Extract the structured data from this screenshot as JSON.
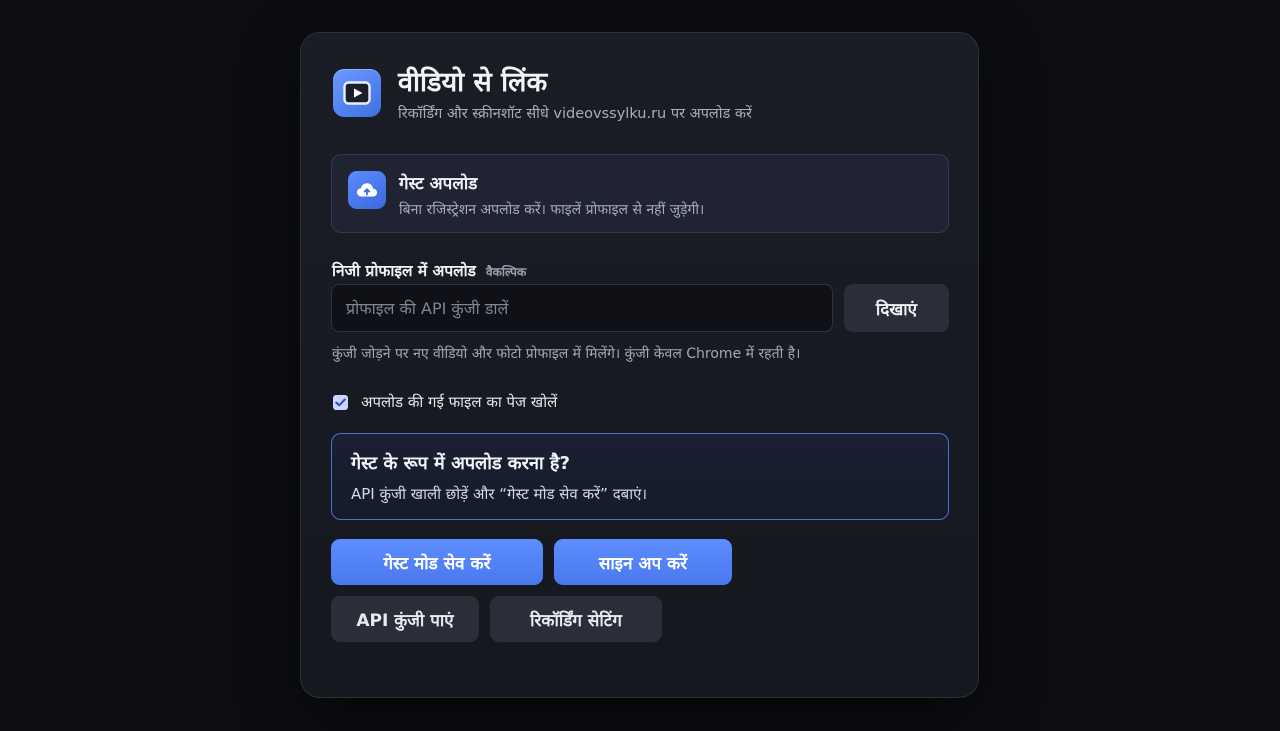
{
  "header": {
    "title": "वीडियो से लिंक",
    "subtitle": "रिकॉर्डिंग और स्क्रीनशॉट सीधे videovssylku.ru पर अपलोड करें"
  },
  "guest_card": {
    "title": "गेस्ट अपलोड",
    "description": "बिना रजिस्ट्रेशन अपलोड करें। फाइलें प्रोफाइल से नहीं जुड़ेगी।"
  },
  "profile_field": {
    "label": "निजी प्रोफाइल में अपलोड",
    "optional_tag": "वैकल्पिक",
    "placeholder": "प्रोफाइल की API कुंजी डालें",
    "value": "",
    "show_label": "दिखाएं",
    "hint": "कुंजी जोड़ने पर नए वीडियो और फोटो प्रोफाइल में मिलेंगे।  कुंजी केवल Chrome में रहती है।"
  },
  "open_page_checkbox": {
    "label": "अपलोड की गई फाइल का पेज खोलें",
    "checked": true
  },
  "info_card": {
    "title": "गेस्ट के रूप में अपलोड करना है?",
    "description": "API कुंजी खाली छोड़ें और “गेस्ट मोड सेव करें” दबाएं।"
  },
  "buttons": {
    "save_guest": "गेस्ट मोड सेव करें",
    "sign_up": "साइन अप करें",
    "get_api_key": "API कुंजी पाएं",
    "recording_settings": "रिकॉर्डिंग सेटिंग"
  },
  "colors": {
    "accent": "#5d8dff",
    "panel_bg": "#1a1d25",
    "page_bg": "#0d0e12"
  },
  "icons": {
    "app": "play-icon",
    "guest": "cloud-upload-icon",
    "checkbox": "check-icon"
  }
}
